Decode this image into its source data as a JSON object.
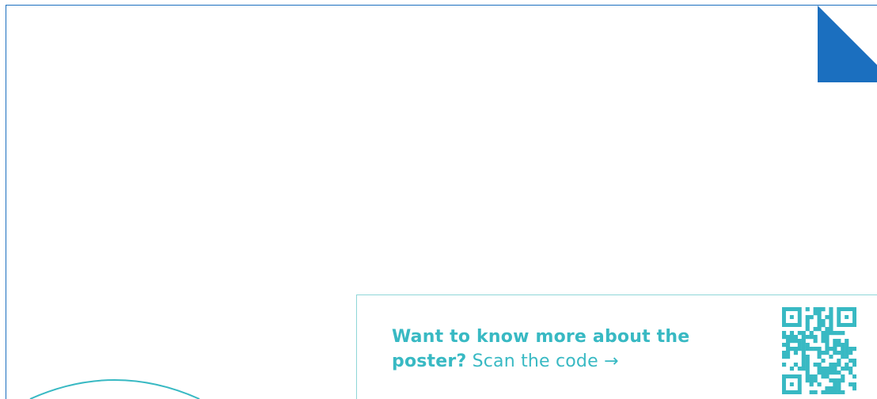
{
  "poster": {
    "frame_color": "#1b6fbf",
    "corner_color": "#1b6fbf",
    "accent_color": "#38b9c3",
    "box_border_color": "#8fd6d8"
  },
  "info": {
    "lead_bold": "Want to know more about the poster?",
    "lead_rest": " Scan the code",
    "arrow": "→"
  },
  "icons": {
    "qr": "qr-code-icon",
    "arrow": "arrow-right-icon"
  }
}
